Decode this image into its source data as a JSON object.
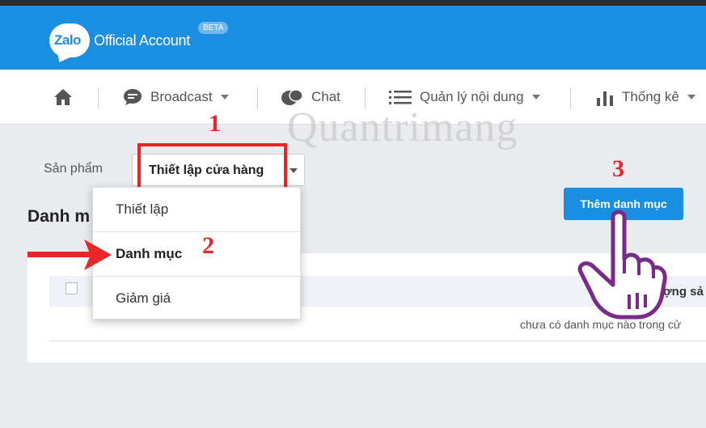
{
  "header": {
    "logo": "Zalo",
    "title": "Official Account",
    "badge": "BETA",
    "bg_color": "#1a8ee1"
  },
  "nav": {
    "items": [
      {
        "icon": "home-icon",
        "label": ""
      },
      {
        "icon": "speech-bubble-icon",
        "label": "Broadcast",
        "dropdown": true
      },
      {
        "icon": "chat-icon",
        "label": "Chat",
        "dropdown": false
      },
      {
        "icon": "list-icon",
        "label": "Quản lý nội dung",
        "dropdown": true
      },
      {
        "icon": "bar-chart-icon",
        "label": "Thống kê",
        "dropdown": true
      }
    ]
  },
  "product": {
    "label": "Sản phẩm",
    "selected": "Thiết lập cửa hàng"
  },
  "dropdown": {
    "items": [
      "Thiết lập",
      "Danh mục",
      "Giảm giá"
    ]
  },
  "page": {
    "title": "Danh m",
    "add_button": "Thêm danh mục",
    "column_header": "ợng sả",
    "empty_message": "chưa có danh mục nào trong cử"
  },
  "annotations": {
    "step1": "1",
    "step2": "2",
    "step3": "3",
    "color": "#e8262a"
  },
  "watermark": "Quantrimang"
}
